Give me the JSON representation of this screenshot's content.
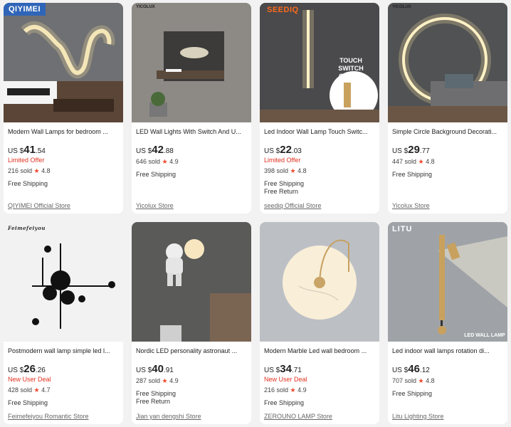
{
  "products": [
    {
      "brand_tag": "QIYIMEI",
      "title": "Modern Wall Lamps for bedroom ...",
      "currency": "US $",
      "price_int": "41",
      "price_dec": ".54",
      "offer": "Limited Offer",
      "sold": "216 sold",
      "rating": "4.8",
      "shipping": [
        "Free Shipping"
      ],
      "store": "QIYIMEI Official Store"
    },
    {
      "brand_tag": "YICOLUX",
      "title": "LED Wall Lights With Switch And U...",
      "currency": "US $",
      "price_int": "42",
      "price_dec": ".88",
      "offer": "",
      "sold": "646 sold",
      "rating": "4.9",
      "shipping": [
        "Free Shipping"
      ],
      "store": "Yicolux Store"
    },
    {
      "brand_tag": "SEEDIQ",
      "overlay": "TOUCH SWITCH\nON/OFF",
      "title": "Led Indoor Wall Lamp Touch Switc...",
      "currency": "US $",
      "price_int": "22",
      "price_dec": ".03",
      "offer": "Limited Offer",
      "sold": "398 sold",
      "rating": "4.8",
      "shipping": [
        "Free Shipping",
        "Free Return"
      ],
      "store": "seediq Official Store"
    },
    {
      "brand_tag": "YICOLUX",
      "title": "Simple Circle Background Decorati...",
      "currency": "US $",
      "price_int": "29",
      "price_dec": ".77",
      "offer": "",
      "sold": "447 sold",
      "rating": "4.8",
      "shipping": [
        "Free Shipping"
      ],
      "store": "Yicolux Store"
    },
    {
      "brand_tag": "Feimefeiyou",
      "title": "Postmodern wall lamp simple led l...",
      "currency": "US $",
      "price_int": "26",
      "price_dec": ".26",
      "offer": "New User Deal",
      "sold": "428 sold",
      "rating": "4.7",
      "shipping": [
        "Free Shipping"
      ],
      "store": "Feimefeiyou Romantic Store"
    },
    {
      "brand_tag": "",
      "title": "Nordic LED personality astronaut ...",
      "currency": "US $",
      "price_int": "40",
      "price_dec": ".91",
      "offer": "",
      "sold": "287 sold",
      "rating": "4.9",
      "shipping": [
        "Free Shipping",
        "Free Return"
      ],
      "store": "Jian yan dengshi Store"
    },
    {
      "brand_tag": "",
      "title": "Modern Marble Led wall bedroom ...",
      "currency": "US $",
      "price_int": "34",
      "price_dec": ".71",
      "offer": "New User Deal",
      "sold": "216 sold",
      "rating": "4.9",
      "shipping": [
        "Free Shipping"
      ],
      "store": "ZEROUNO LAMP Store"
    },
    {
      "brand_tag": "LITU",
      "overlay": "LED WALL LAMP",
      "title": "Led indoor wall lamps rotation di...",
      "currency": "US $",
      "price_int": "46",
      "price_dec": ".12",
      "offer": "",
      "sold": "707 sold",
      "rating": "4.8",
      "shipping": [
        "Free Shipping"
      ],
      "store": "Litu Lighting Store"
    }
  ],
  "star_glyph": "★",
  "colors": {
    "offer_red": "#e0311f",
    "star_red": "#f04a30",
    "brand_blue": "#2f65b8"
  }
}
